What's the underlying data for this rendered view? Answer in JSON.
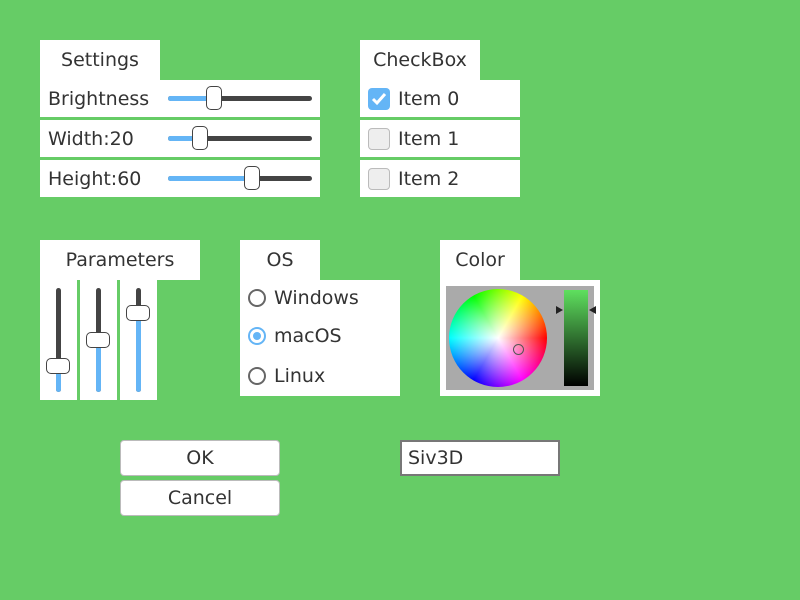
{
  "settings": {
    "title": "Settings",
    "sliders": [
      {
        "label": "Brightness",
        "value": 0.32
      },
      {
        "label": "Width:20",
        "value": 0.22
      },
      {
        "label": "Height:60",
        "value": 0.59
      }
    ]
  },
  "checkbox": {
    "title": "CheckBox",
    "items": [
      {
        "label": "Item 0",
        "checked": true
      },
      {
        "label": "Item 1",
        "checked": false
      },
      {
        "label": "Item 2",
        "checked": false
      }
    ]
  },
  "parameters": {
    "title": "Parameters",
    "values": [
      0.25,
      0.52,
      0.78
    ]
  },
  "os": {
    "title": "OS",
    "options": [
      "Windows",
      "macOS",
      "Linux"
    ],
    "selected": "macOS"
  },
  "color": {
    "title": "Color"
  },
  "buttons": {
    "ok": "OK",
    "cancel": "Cancel"
  },
  "textbox": {
    "value": "Siv3D"
  },
  "colors": {
    "background": "#66cc66",
    "accent": "#64b5f6"
  }
}
